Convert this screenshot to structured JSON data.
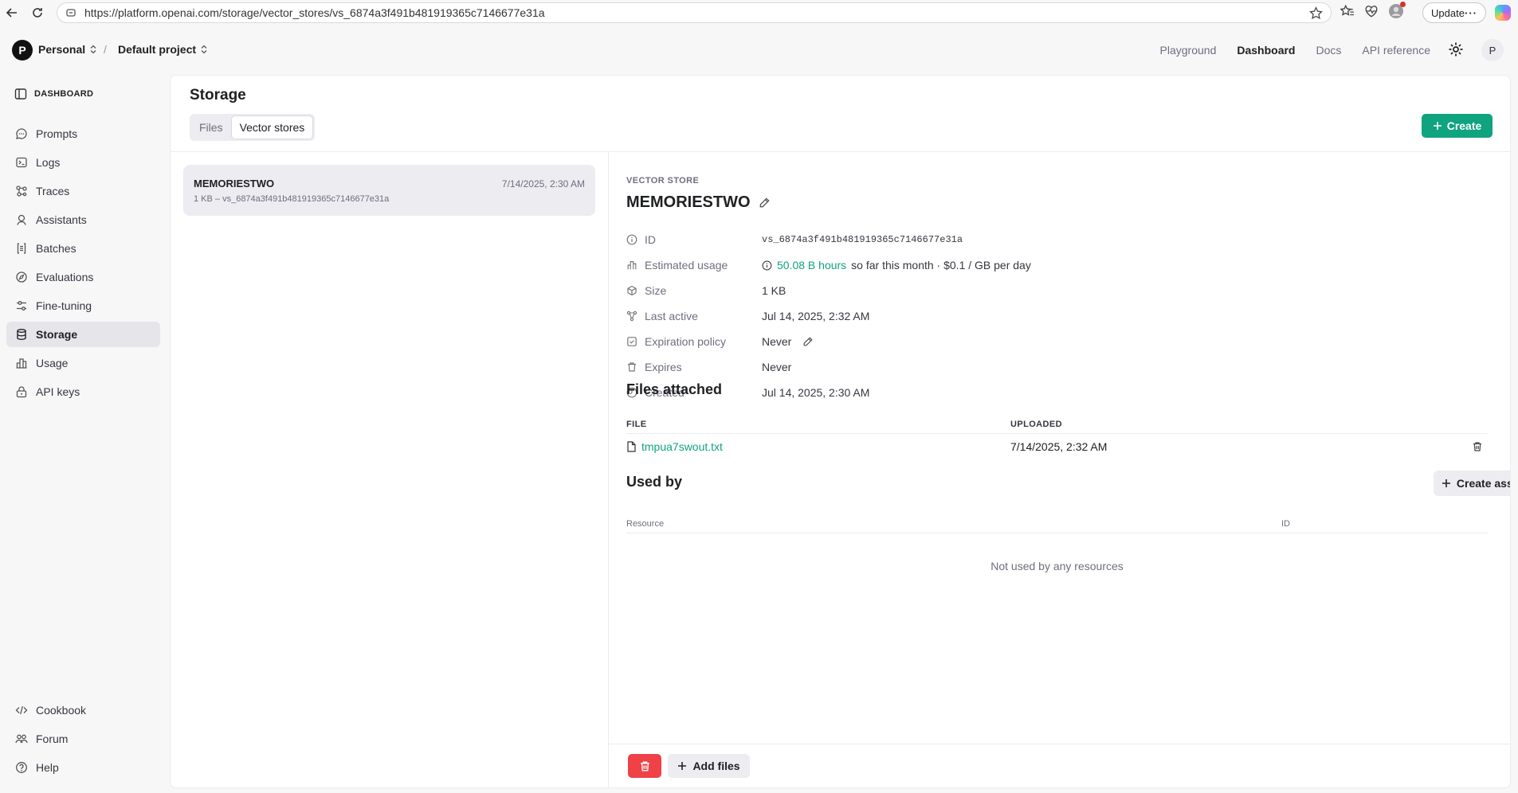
{
  "browser": {
    "url": "https://platform.openai.com/storage/vector_stores/vs_6874a3f491b481919365c7146677e31a",
    "update_label": "Update"
  },
  "header": {
    "org_initial": "P",
    "org_name": "Personal",
    "project_name": "Default project",
    "nav": [
      "Playground",
      "Dashboard",
      "Docs",
      "API reference"
    ],
    "active_nav": "Dashboard",
    "user_initial": "P"
  },
  "sidebar": {
    "heading": "DASHBOARD",
    "items": [
      {
        "label": "Prompts",
        "icon": "prompts-icon"
      },
      {
        "label": "Logs",
        "icon": "logs-icon"
      },
      {
        "label": "Traces",
        "icon": "traces-icon"
      },
      {
        "label": "Assistants",
        "icon": "assistants-icon"
      },
      {
        "label": "Batches",
        "icon": "batches-icon"
      },
      {
        "label": "Evaluations",
        "icon": "evaluations-icon"
      },
      {
        "label": "Fine-tuning",
        "icon": "fine-tuning-icon"
      },
      {
        "label": "Storage",
        "icon": "storage-icon",
        "active": true
      },
      {
        "label": "Usage",
        "icon": "usage-icon"
      },
      {
        "label": "API keys",
        "icon": "api-keys-icon"
      }
    ],
    "bottom": [
      {
        "label": "Cookbook",
        "icon": "code-icon"
      },
      {
        "label": "Forum",
        "icon": "forum-icon"
      },
      {
        "label": "Help",
        "icon": "help-icon"
      }
    ]
  },
  "main": {
    "title": "Storage",
    "tabs": [
      "Files",
      "Vector stores"
    ],
    "active_tab": "Vector stores",
    "create_label": "Create",
    "store_card": {
      "name": "MEMORIESTWO",
      "date": "7/14/2025, 2:30 AM",
      "meta": "1 KB – vs_6874a3f491b481919365c7146677e31a"
    }
  },
  "detail": {
    "label": "VECTOR STORE",
    "name": "MEMORIESTWO",
    "properties": {
      "id": {
        "label": "ID",
        "value": "vs_6874a3f491b481919365c7146677e31a"
      },
      "usage": {
        "label": "Estimated usage",
        "highlight": "50.08 B hours",
        "rest": "so far this month · $0.1 / GB per day"
      },
      "size": {
        "label": "Size",
        "value": "1 KB"
      },
      "last_active": {
        "label": "Last active",
        "value": "Jul 14, 2025, 2:32 AM"
      },
      "expiration": {
        "label": "Expiration policy",
        "value": "Never"
      },
      "expires": {
        "label": "Expires",
        "value": "Never"
      },
      "created": {
        "label": "Created",
        "value": "Jul 14, 2025, 2:30 AM"
      }
    },
    "files_title": "Files attached",
    "files_columns": [
      "FILE",
      "UPLOADED"
    ],
    "files": [
      {
        "name": "tmpua7swout.txt",
        "uploaded": "7/14/2025, 2:32 AM"
      }
    ],
    "used_by_title": "Used by",
    "create_assistant_label": "Create assistant",
    "used_columns": [
      "Resource",
      "ID"
    ],
    "empty_message": "Not used by any resources",
    "add_files_label": "Add files"
  },
  "colors": {
    "accent": "#10a37f",
    "danger": "#ef4146"
  }
}
